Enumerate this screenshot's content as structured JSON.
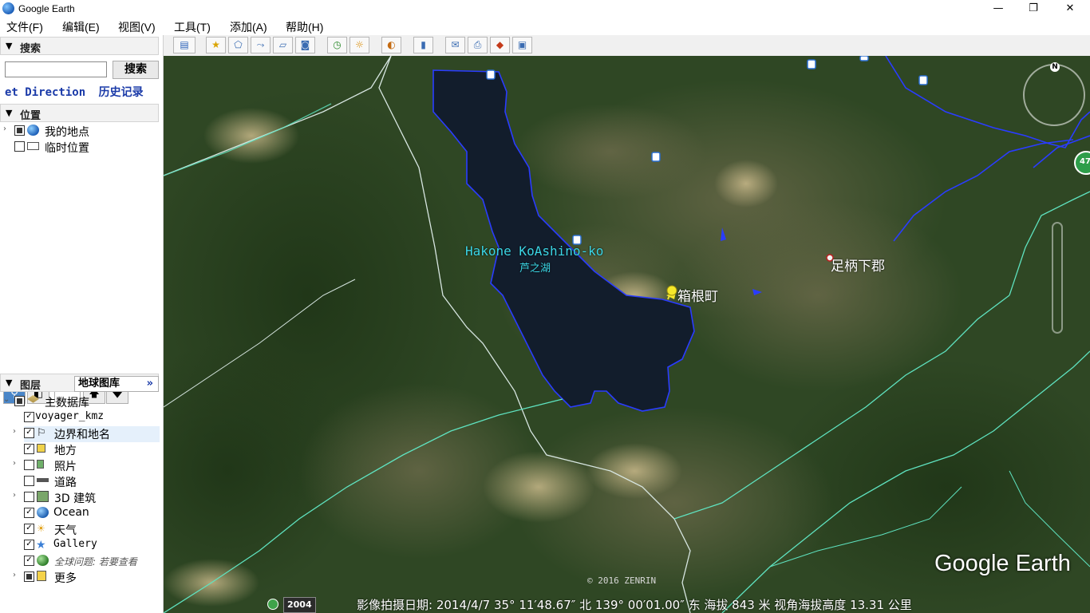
{
  "window": {
    "title": "Google Earth"
  },
  "menu": [
    {
      "label": "文件(F)"
    },
    {
      "label": "编辑(E)"
    },
    {
      "label": "视图(V)"
    },
    {
      "label": "工具(T)"
    },
    {
      "label": "添加(A)"
    },
    {
      "label": "帮助(H)"
    }
  ],
  "search": {
    "header": "搜索",
    "button": "搜索",
    "input_value": "",
    "link_directions": "et Direction",
    "link_history": "历史记录"
  },
  "places": {
    "header": "位置",
    "items": [
      {
        "label": "我的地点"
      },
      {
        "label": "临时位置"
      }
    ]
  },
  "layers": {
    "header": "图层",
    "gallery_button": "地球图库",
    "gallery_arrows": "»",
    "root": "主数据库",
    "items": [
      {
        "label": "voyager_kmz"
      },
      {
        "label": "边界和地名"
      },
      {
        "label": "地方"
      },
      {
        "label": "照片"
      },
      {
        "label": "道路"
      },
      {
        "label": "3D 建筑"
      },
      {
        "label": "Ocean"
      },
      {
        "label": "天气"
      },
      {
        "label": "Gallery"
      },
      {
        "label": "全球问题: 若要查看"
      },
      {
        "label": "更多"
      }
    ]
  },
  "map": {
    "labels": {
      "lake_en": "Hakone KoAshino-ko",
      "lake_jp": "芦之湖",
      "town": "箱根町",
      "district": "足柄下郡",
      "route_badge": "47"
    },
    "copyright": "© 2016 ZENRIN",
    "logo": "Google Earth",
    "compass_north": "N"
  },
  "status": {
    "year": "2004",
    "text": "影像拍摄日期: 2014/4/7  35° 11′48.67″ 北 139° 00′01.00″ 东 海拔   843 米  视角海拔高度  13.31 公里"
  },
  "colors": {
    "lake": "#0f1c2c",
    "boundary_white": "#d7e6e1",
    "boundary_cyan": "#5fe3c0",
    "border_blue": "#2a3cff",
    "label_cyan": "#3bd6e6"
  }
}
